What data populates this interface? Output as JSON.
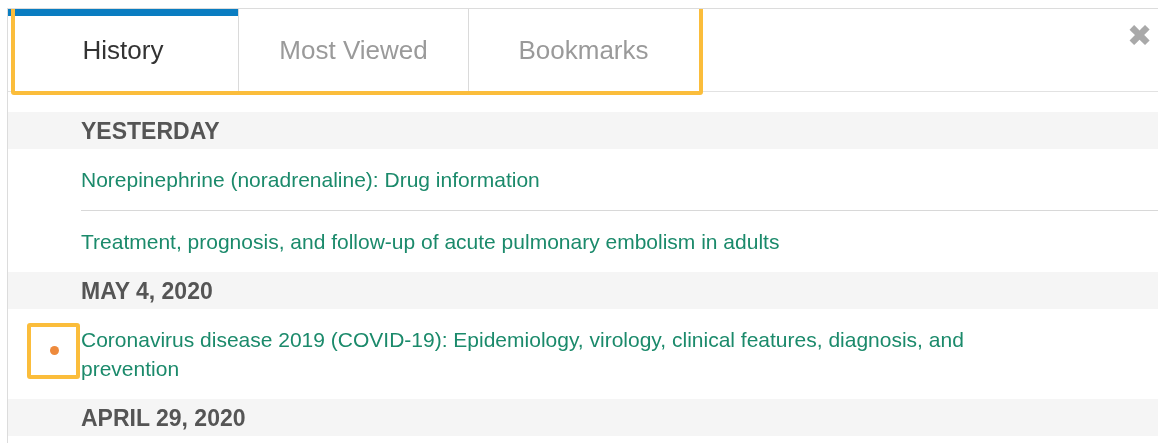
{
  "tabs_highlighted": true,
  "tabs": [
    {
      "label": "History",
      "selected": true
    },
    {
      "label": "Most Viewed",
      "selected": false
    },
    {
      "label": "Bookmarks",
      "selected": false
    }
  ],
  "close": "✖",
  "sections": [
    {
      "heading": "YESTERDAY",
      "items": [
        {
          "title": "Norepinephrine (noradrenaline): Drug information",
          "marked": false,
          "highlighted": false
        },
        {
          "title": "Treatment, prognosis, and follow-up of acute pulmonary embolism in adults",
          "marked": false,
          "highlighted": false
        }
      ]
    },
    {
      "heading": "MAY 4, 2020",
      "items": [
        {
          "title": "Coronavirus disease 2019 (COVID-19): Epidemiology, virology, clinical features, diagnosis, and prevention",
          "marked": true,
          "highlighted": true
        }
      ]
    },
    {
      "heading": "APRIL 29, 2020"
    }
  ]
}
